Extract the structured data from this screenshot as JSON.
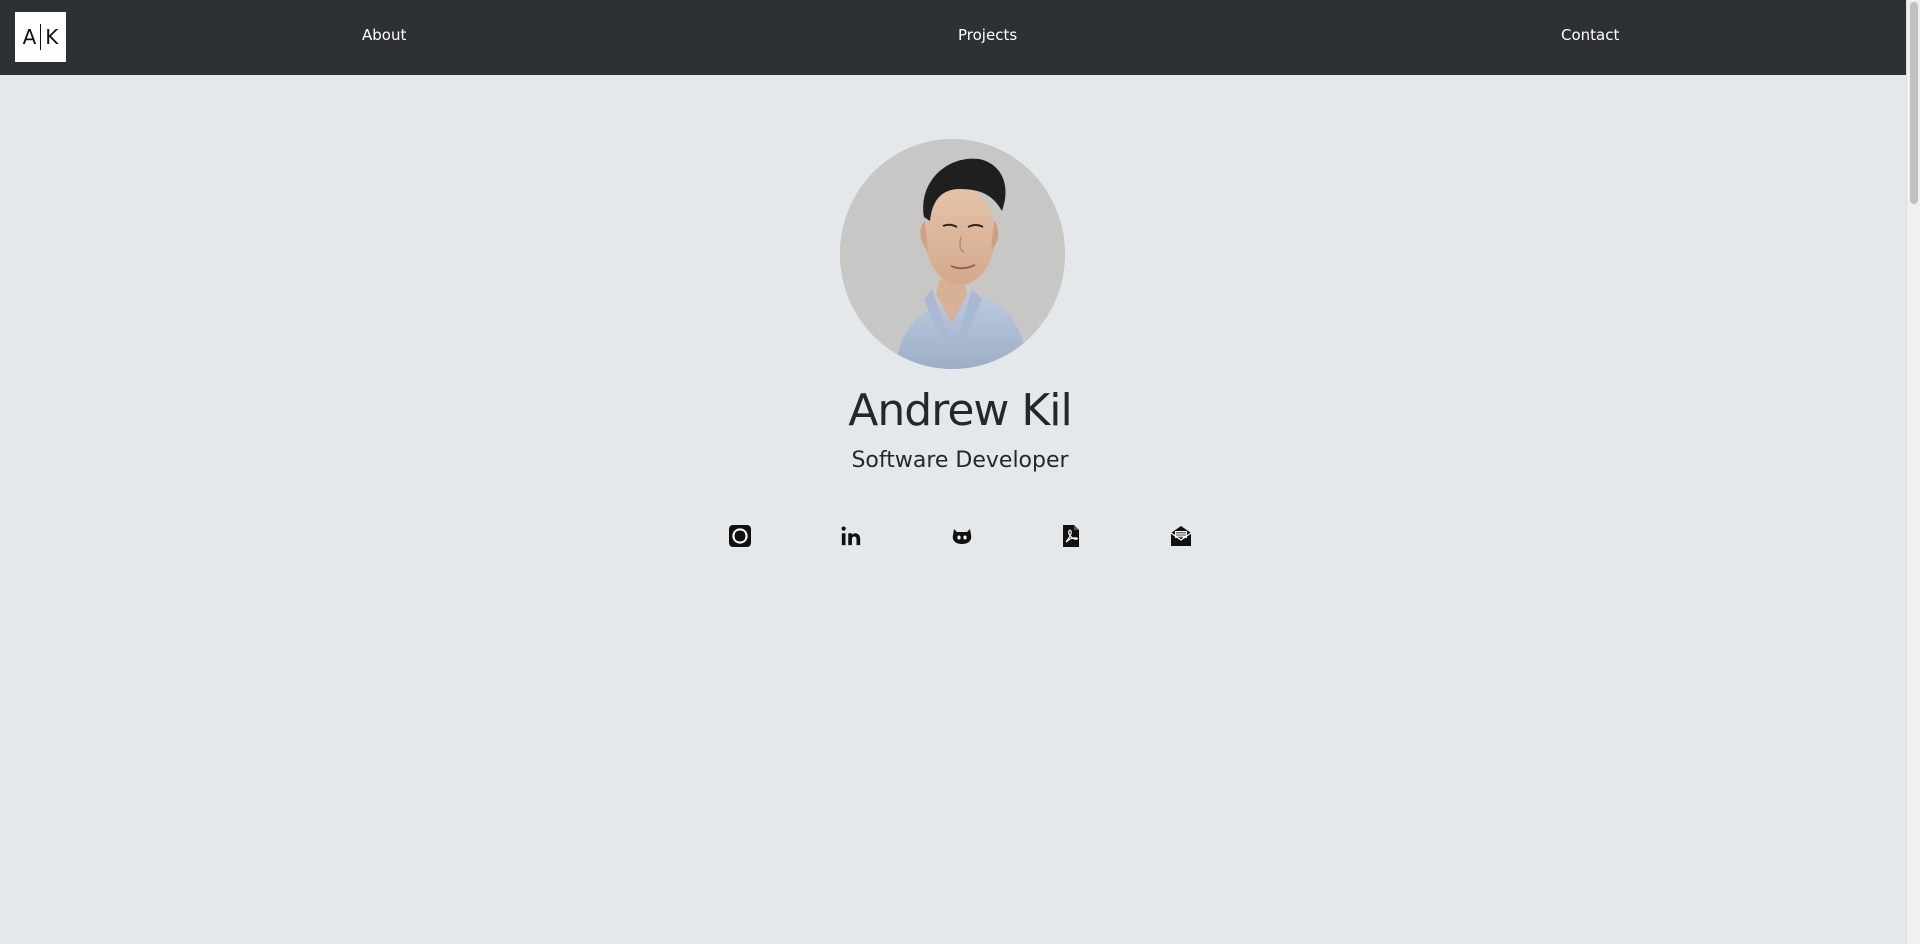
{
  "nav": {
    "logo_left": "A",
    "logo_right": "K",
    "links": [
      {
        "label": "About"
      },
      {
        "label": "Projects"
      },
      {
        "label": "Contact"
      }
    ]
  },
  "profile": {
    "name": "Andrew Kil",
    "title": "Software Developer",
    "avatar": "profile-photo"
  },
  "social_icons": [
    {
      "icon": "codepen-swirl-icon"
    },
    {
      "icon": "linkedin-icon"
    },
    {
      "icon": "github-icon"
    },
    {
      "icon": "pdf-resume-icon"
    },
    {
      "icon": "email-icon"
    }
  ],
  "colors": {
    "navbar": "#2d3136",
    "background": "#e4e8eb",
    "text": "#24282c"
  }
}
